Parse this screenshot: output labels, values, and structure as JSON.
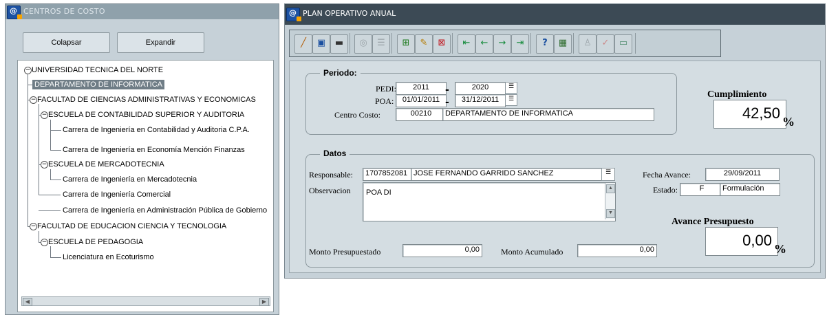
{
  "left_window": {
    "title": "CENTROS DE COSTO",
    "collapse_label": "Colapsar",
    "expand_label": "Expandir",
    "tree": [
      {
        "label": "UNIVERSIDAD TECNICA DEL NORTE",
        "level": 0,
        "toggle": "−"
      },
      {
        "label": "DEPARTAMENTO DE INFORMATICA",
        "level": 1,
        "selected": true
      },
      {
        "label": "FACULTAD DE CIENCIAS ADMINISTRATIVAS Y ECONOMICAS",
        "level": 1,
        "toggle": "−"
      },
      {
        "label": "ESCUELA DE CONTABILIDAD SUPERIOR Y AUDITORIA",
        "level": 2,
        "toggle": "−"
      },
      {
        "label": "Carrera de Ingeniería en Contabilidad y Auditoria C.P.A.",
        "level": 3
      },
      {
        "label": "Carrera de Ingeniería en Economía Mención Finanzas",
        "level": 3
      },
      {
        "label": "ESCUELA DE MERCADOTECNIA",
        "level": 2,
        "toggle": "−"
      },
      {
        "label": "Carrera de Ingeniería en Mercadotecnia",
        "level": 3
      },
      {
        "label": "Carrera de Ingeniería Comercial",
        "level": 2
      },
      {
        "label": "Carrera de Ingeniería en Administración Pública de Gobierno",
        "level": 2
      },
      {
        "label": "FACULTAD DE EDUCACION CIENCIA Y TECNOLOGIA",
        "level": 1,
        "toggle": "−"
      },
      {
        "label": "ESCUELA DE PEDAGOGIA",
        "level": 2,
        "toggle": "−"
      },
      {
        "label": "Licenciatura en Ecoturismo",
        "level": 3
      }
    ]
  },
  "right_window": {
    "title": "PLAN OPERATIVO ANUAL",
    "toolbar_icons": [
      "broom-icon",
      "save-icon",
      "print-icon",
      "search-icon",
      "list-icon",
      "insert-record-icon",
      "edit-record-icon",
      "delete-record-icon",
      "first-record-icon",
      "previous-record-icon",
      "next-record-icon",
      "last-record-icon",
      "help-icon",
      "exit-icon",
      "user-icon",
      "check-icon",
      "window-icon"
    ],
    "periodo": {
      "group_label": "Periodo:",
      "pedi_label": "PEDI:",
      "pedi_from": "2011",
      "pedi_to": "2020",
      "poa_label": "POA:",
      "poa_from": "01/01/2011",
      "poa_to": "31/12/2011",
      "centro_label": "Centro Costo:",
      "centro_code": "00210",
      "centro_name": "DEPARTAMENTO DE INFORMATICA",
      "dash": "-"
    },
    "cumplimiento": {
      "label": "Cumplimiento",
      "value": "42,50",
      "unit": "%"
    },
    "datos": {
      "group_label": "Datos",
      "responsable_label": "Responsable:",
      "responsable_id": "1707852081",
      "responsable_name": "JOSE FERNANDO GARRIDO SANCHEZ",
      "observacion_label": "Observacion",
      "observacion_value": "POA DI",
      "fecha_avance_label": "Fecha Avance:",
      "fecha_avance_value": "29/09/2011",
      "estado_label": "Estado:",
      "estado_code": "F",
      "estado_name": "Formulación",
      "avance_label": "Avance Presupuesto",
      "avance_value": "0,00",
      "avance_unit": "%",
      "monto_presupuestado_label": "Monto Presupuestado",
      "monto_presupuestado_value": "0,00",
      "monto_acumulado_label": "Monto Acumulado",
      "monto_acumulado_value": "0,00"
    }
  }
}
